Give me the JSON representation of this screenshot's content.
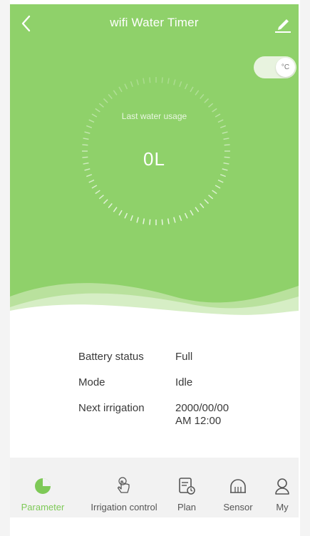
{
  "header": {
    "title": "wifi Water Timer"
  },
  "unit_toggle": {
    "label": "°C",
    "on": true
  },
  "gauge": {
    "label": "Last water usage",
    "value": "0L"
  },
  "info": [
    {
      "key": "Battery status",
      "value": "Full"
    },
    {
      "key": "Mode",
      "value": "Idle"
    },
    {
      "key": "Next  irrigation",
      "value_line1": "2000/00/00",
      "value_line2": "AM 12:00"
    }
  ],
  "tabs": [
    {
      "label": "Parameter",
      "icon": "pie-chart-icon",
      "active": true
    },
    {
      "label": "Irrigation control",
      "icon": "hand-pointer-icon",
      "active": false
    },
    {
      "label": "Plan",
      "icon": "schedule-icon",
      "active": false
    },
    {
      "label": "Sensor",
      "icon": "sensor-icon",
      "active": false
    },
    {
      "label": "My",
      "icon": "user-icon",
      "active": false
    }
  ],
  "colors": {
    "hero": "#8fd16a",
    "accent": "#7ec957",
    "tabbar": "#f2f2f2"
  }
}
